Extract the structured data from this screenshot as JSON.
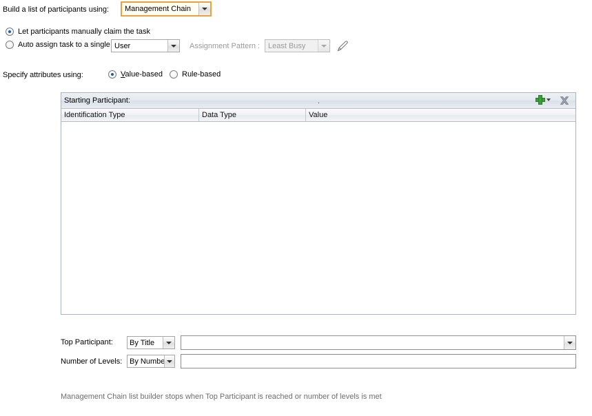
{
  "build_row": {
    "label": "Build a list of participants using:",
    "selected": "Management Chain",
    "highlight_color": "#e8a33d"
  },
  "assignment": {
    "manual_label": "Let participants manually claim the task",
    "auto_label": "Auto assign task to a single",
    "auto_target": "User",
    "pattern_label": "Assignment Pattern :",
    "pattern_value": "Least Busy",
    "edit_icon": "pencil-icon"
  },
  "attributes": {
    "label": "Specify attributes using:",
    "value_based": "Value-based",
    "rule_based": "Rule-based"
  },
  "table": {
    "title": "Starting Participant:",
    "center_marker": ".",
    "add_icon": "plus-icon",
    "delete_icon": "delete-x-icon",
    "columns": [
      "Identification Type",
      "Data Type",
      "Value"
    ],
    "rows": []
  },
  "bottom": {
    "top_participant_label": "Top Participant:",
    "top_participant_mode": "By Title",
    "top_participant_value": "",
    "levels_label": "Number of Levels:",
    "levels_mode": "By Number",
    "levels_value": ""
  },
  "footer": {
    "note": "Management Chain list builder stops when Top Participant is reached or number of levels is met"
  }
}
